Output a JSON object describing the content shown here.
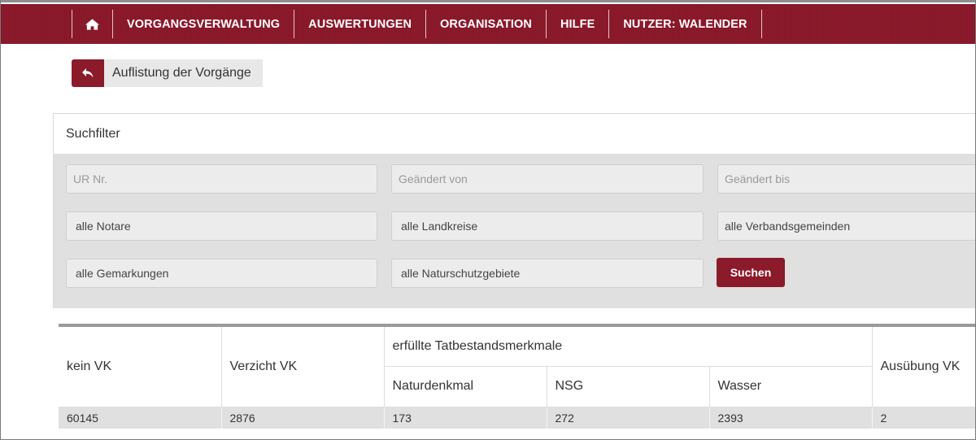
{
  "nav": {
    "home_icon": "home-icon",
    "items": [
      "VORGANGSVERWALTUNG",
      "AUSWERTUNGEN",
      "ORGANISATION",
      "HILFE",
      "NUTZER: WALENDER"
    ]
  },
  "page": {
    "back_icon": "reply-arrow-icon",
    "title": "Auflistung der Vorgänge"
  },
  "filter": {
    "title": "Suchfilter",
    "ur_nr_placeholder": "UR Nr.",
    "changed_from_placeholder": "Geändert von",
    "changed_to_placeholder": "Geändert bis",
    "notary": "alle Notare",
    "district": "alle Landkreise",
    "municipality": "alle Verbandsgemeinden",
    "cadastral": "alle Gemarkungen",
    "nature_reserve": "alle Naturschutzgebiete",
    "search_label": "Suchen"
  },
  "stats": {
    "headers": {
      "kein_vk": "kein VK",
      "verzicht_vk": "Verzicht VK",
      "group": "erfüllte Tatbestandsmerkmale",
      "naturdenkmal": "Naturdenkmal",
      "nsg": "NSG",
      "wasser": "Wasser",
      "ausuebung_vk": "Ausübung VK"
    },
    "values": {
      "kein_vk": "60145",
      "verzicht_vk": "2876",
      "naturdenkmal": "173",
      "nsg": "272",
      "wasser": "2393",
      "ausuebung_vk": "2"
    }
  },
  "colors": {
    "brand": "#8b1a2b",
    "panel_bg": "#e0e0e0"
  }
}
